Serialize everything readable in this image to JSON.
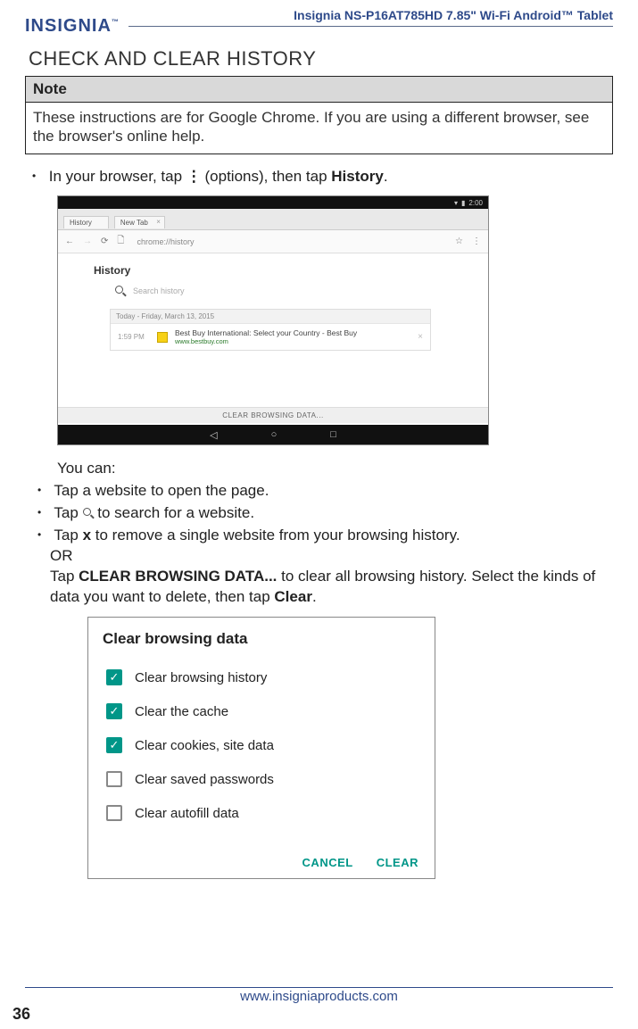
{
  "header": {
    "logo": "INSIGNIA",
    "doc_title": "Insignia  NS-P16AT785HD  7.85\" Wi-Fi Android™ Tablet"
  },
  "section_title": "CHECK AND CLEAR HISTORY",
  "note": {
    "label": "Note",
    "body": "These instructions are for Google Chrome. If you are using a different browser, see the browser's online help."
  },
  "step1_pre": "In your browser, tap",
  "step1_mid": " (options), then tap ",
  "step1_bold": "History",
  "step1_end": ".",
  "screenshot1": {
    "time": "2:00",
    "tab1": "History",
    "tab2": "New Tab",
    "url": "chrome://history",
    "heading": "History",
    "search_placeholder": "Search history",
    "date_label": "Today - Friday, March 13, 2015",
    "entry_time": "1:59 PM",
    "entry_title": "Best Buy International: Select your Country - Best Buy",
    "entry_sub": "www.bestbuy.com",
    "clear_label": "CLEAR BROWSING DATA..."
  },
  "you_can": "You can:",
  "sub1": "Tap a website to open the page.",
  "sub2_pre": "Tap ",
  "sub2_post": " to search for a website.",
  "sub3_pre": "Tap ",
  "sub3_x": "x",
  "sub3_mid": " to remove a single website from your browsing history.",
  "sub3_or": "OR",
  "sub3_line2_pre": "Tap ",
  "sub3_bold": "CLEAR BROWSING DATA...",
  "sub3_line2_mid": " to clear all browsing history. Select the kinds of data you want to delete, then tap ",
  "sub3_clear": "Clear",
  "sub3_end": ".",
  "screenshot2": {
    "title": "Clear browsing data",
    "opt1": "Clear browsing history",
    "opt2": "Clear the cache",
    "opt3": "Clear cookies, site data",
    "opt4": "Clear saved passwords",
    "opt5": "Clear autofill data",
    "cancel": "CANCEL",
    "clear": "CLEAR"
  },
  "footer_url": "www.insigniaproducts.com",
  "page_number": "36"
}
